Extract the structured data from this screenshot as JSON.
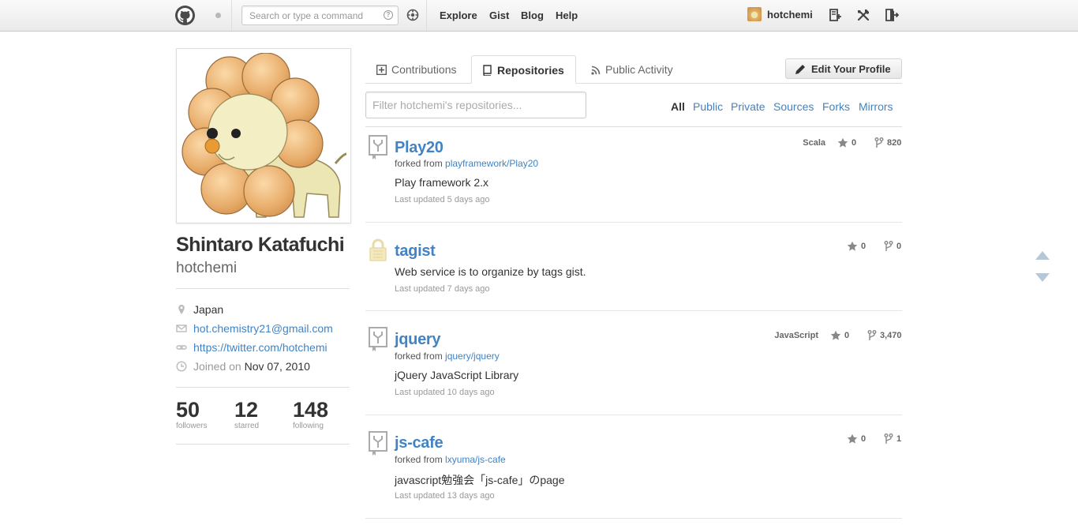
{
  "header": {
    "search_placeholder": "Search or type a command",
    "nav": [
      "Explore",
      "Gist",
      "Blog",
      "Help"
    ],
    "username": "hotchemi",
    "icons": [
      "github-logo-icon",
      "notification-dot-icon",
      "search-help-icon",
      "command-palette-icon",
      "new-repo-icon",
      "account-settings-icon",
      "sign-out-icon"
    ]
  },
  "profile": {
    "full_name": "Shintaro Katafuchi",
    "login": "hotchemi",
    "location": "Japan",
    "email": "hot.chemistry21@gmail.com",
    "website": "https://twitter.com/hotchemi",
    "joined_label": "Joined on",
    "joined_date": "Nov 07, 2010",
    "stats": [
      {
        "num": "50",
        "label": "followers"
      },
      {
        "num": "12",
        "label": "starred"
      },
      {
        "num": "148",
        "label": "following"
      }
    ]
  },
  "tabs": {
    "contributions": "Contributions",
    "repositories": "Repositories",
    "public_activity": "Public Activity",
    "selected": "Repositories"
  },
  "edit_profile_label": "Edit Your Profile",
  "filter": {
    "placeholder": "Filter hotchemi's repositories...",
    "types": [
      "All",
      "Public",
      "Private",
      "Sources",
      "Forks",
      "Mirrors"
    ],
    "active": "All"
  },
  "repos": [
    {
      "name": "Play20",
      "forked_label": "forked from",
      "forked_from": "playframework/Play20",
      "description": "Play framework 2.x",
      "updated": "Last updated 5 days ago",
      "language": "Scala",
      "stars": "0",
      "forks": "820",
      "kind": "fork"
    },
    {
      "name": "tagist",
      "description": "Web service is to organize by tags gist.",
      "updated": "Last updated 7 days ago",
      "language": "",
      "stars": "0",
      "forks": "0",
      "kind": "private"
    },
    {
      "name": "jquery",
      "forked_label": "forked from",
      "forked_from": "jquery/jquery",
      "description": "jQuery JavaScript Library",
      "updated": "Last updated 10 days ago",
      "language": "JavaScript",
      "stars": "0",
      "forks": "3,470",
      "kind": "fork"
    },
    {
      "name": "js-cafe",
      "forked_label": "forked from",
      "forked_from": "lxyuma/js-cafe",
      "description": "javascript勉強会「js-cafe」のpage",
      "updated": "Last updated 13 days ago",
      "language": "",
      "stars": "0",
      "forks": "1",
      "kind": "fork"
    }
  ],
  "colors": {
    "link": "#4183c4",
    "private_lock": "#e9dba5",
    "fork_icon": "#aaaaaa"
  }
}
